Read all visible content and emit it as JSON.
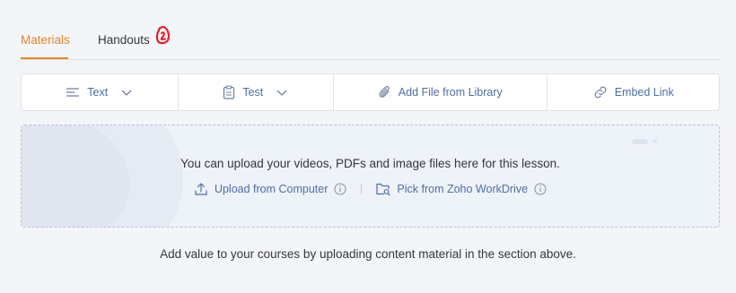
{
  "tabs": [
    {
      "label": "Materials",
      "active": true
    },
    {
      "label": "Handouts",
      "active": false
    }
  ],
  "toolbar": {
    "text_label": "Text",
    "test_label": "Test",
    "add_file_label": "Add File from Library",
    "embed_link_label": "Embed Link"
  },
  "dropzone": {
    "message": "You can upload your videos, PDFs and image files here for this lesson.",
    "upload_computer_label": "Upload from Computer",
    "pick_workdrive_label": "Pick from Zoho WorkDrive"
  },
  "footer_text": "Add value to your courses by uploading content material in the section above.",
  "colors": {
    "accent": "#e4862f",
    "link": "#4d6fa3",
    "badge": "#e0202b",
    "background": "#f4f5f8"
  },
  "icons": [
    "text-align-icon",
    "chevron-down-icon",
    "clipboard-icon",
    "paperclip-icon",
    "link-icon",
    "upload-icon",
    "info-icon",
    "folder-search-icon",
    "handwritten-badge-icon"
  ]
}
